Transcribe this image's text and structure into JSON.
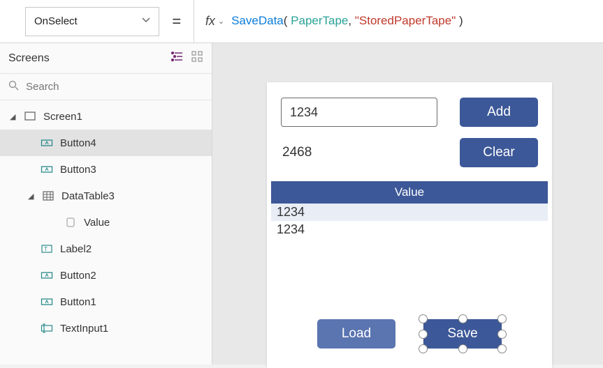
{
  "property_dropdown": {
    "selected": "OnSelect"
  },
  "formula": {
    "fn": "SaveData",
    "arg_id": "PaperTape",
    "arg_str": "\"StoredPaperTape\""
  },
  "panel": {
    "title": "Screens",
    "search_placeholder": "Search"
  },
  "tree": {
    "screen1": "Screen1",
    "button4": "Button4",
    "button3": "Button3",
    "datatable3": "DataTable3",
    "value_col": "Value",
    "label2": "Label2",
    "button2": "Button2",
    "button1": "Button1",
    "textinput1": "TextInput1"
  },
  "canvas": {
    "input_value": "1234",
    "result_label": "2468",
    "add_btn": "Add",
    "clear_btn": "Clear",
    "table_header": "Value",
    "table_rows": [
      "1234",
      "1234"
    ],
    "load_btn": "Load",
    "save_btn": "Save"
  }
}
